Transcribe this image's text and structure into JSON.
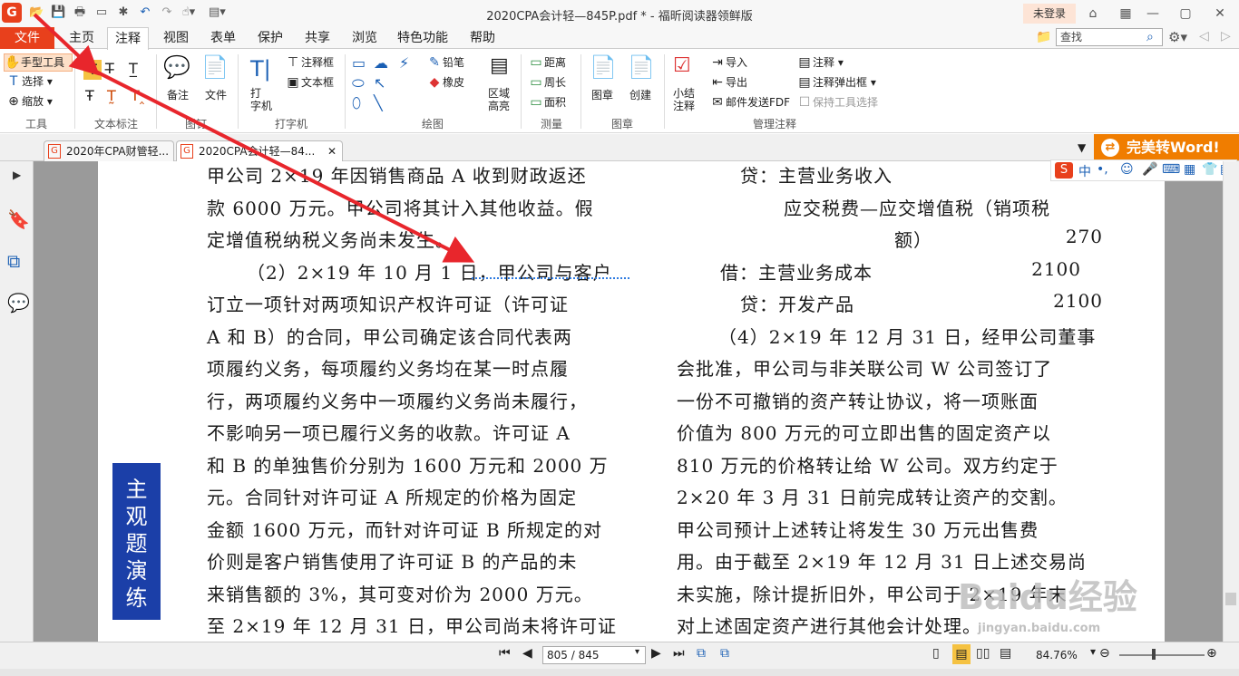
{
  "window": {
    "title": "2020CPA会计轻—845P.pdf * - 福昕阅读器领鲜版",
    "login": "未登录"
  },
  "menu": [
    "文件",
    "主页",
    "注释",
    "视图",
    "表单",
    "保护",
    "共享",
    "浏览",
    "特色功能",
    "帮助"
  ],
  "search_placeholder": "查找",
  "ribbon": {
    "tools": {
      "hand": "手型工具",
      "select": "选择",
      "zoom": "缩放",
      "group": "工具"
    },
    "text_markup": {
      "group": "文本标注"
    },
    "pin": {
      "note": "备注",
      "file": "文件",
      "group": "图钉"
    },
    "typewriter": {
      "typewriter": "打\n字机",
      "annot_box": "注释框",
      "textbox": "文本框",
      "group": "打字机"
    },
    "drawing": {
      "pencil": "铅笔",
      "eraser": "橡皮",
      "area_highlight": "区域\n高亮",
      "group": "绘图"
    },
    "measure": {
      "distance": "距离",
      "perimeter": "周长",
      "area": "面积",
      "group": "测量"
    },
    "stamp": {
      "stamp": "图章",
      "create": "创建",
      "group": "图章"
    },
    "manage": {
      "summary": "小结\n注释",
      "import": "导入",
      "export": "导出",
      "email": "邮件发送FDF",
      "annot": "注释",
      "popup": "注释弹出框",
      "keep": "保持工具选择",
      "group": "管理注释"
    }
  },
  "tabs": [
    "2020年CPA财管轻...",
    "2020CPA会计轻—84..."
  ],
  "word_button": "完美转Word!",
  "document": {
    "left_col": [
      "甲公司 2×19 年因销售商品 A 收到财政返还",
      "款 6000 万元。甲公司将其计入其他收益。假",
      "定增值税纳税义务尚未发生。",
      "（2）2×19 年 10 月 1 日，甲公司与客户",
      "订立一项针对两项知识产权许可证（许可证",
      "A 和 B）的合同，甲公司确定该合同代表两",
      "项履约义务，每项履约义务均在某一时点履",
      "行，两项履约义务中一项履约义务尚未履行，",
      "不影响另一项已履行义务的收款。许可证 A",
      "和 B 的单独售价分别为 1600 万元和 2000 万",
      "元。合同针对许可证 A 所规定的价格为固定",
      "金额 1600 万元，而针对许可证 B 所规定的对",
      "价则是客户销售使用了许可证 B 的产品的未",
      "来销售额的 3%，其可变对价为 2000 万元。",
      "至 2×19 年 12 月 31 日，甲公司尚未将许可证"
    ],
    "right_col": [
      {
        "text": "贷：主营业务收入",
        "amount": ""
      },
      {
        "text": "应交税费—应交增值税（销项税",
        "amount": ""
      },
      {
        "text": "额）",
        "amount": "270"
      },
      {
        "text": "借：主营业务成本",
        "amount": "2100"
      },
      {
        "text": "贷：开发产品",
        "amount": "2100"
      },
      {
        "text": "（4）2×19 年 12 月 31 日，经甲公司董事",
        "amount": ""
      },
      {
        "text": "会批准，甲公司与非关联公司 W 公司签订了",
        "amount": ""
      },
      {
        "text": "一份不可撤销的资产转让协议，将一项账面",
        "amount": ""
      },
      {
        "text": "价值为 800 万元的可立即出售的固定资产以",
        "amount": ""
      },
      {
        "text": "810 万元的价格转让给 W 公司。双方约定于",
        "amount": ""
      },
      {
        "text": "2×20 年 3 月 31 日前完成转让资产的交割。",
        "amount": ""
      },
      {
        "text": "甲公司预计上述转让将发生 30 万元出售费",
        "amount": ""
      },
      {
        "text": "用。由于截至 2×19 年 12 月 31 日上述交易尚",
        "amount": ""
      },
      {
        "text": "未实施，除计提折旧外，甲公司于 2×19 年末",
        "amount": ""
      },
      {
        "text": "对上述固定资产进行其他会计处理。",
        "amount": ""
      }
    ],
    "side_label": "主观题演练"
  },
  "status": {
    "page": "805 / 845",
    "zoom": "84.76%"
  },
  "watermark": {
    "brand": "Baidu经验",
    "url": "jingyan.baidu.com"
  },
  "colors": {
    "accent": "#e8401c",
    "arrow": "#e8262c",
    "side_label_bg": "#1b3fa8",
    "word_btn": "#f07d00"
  }
}
